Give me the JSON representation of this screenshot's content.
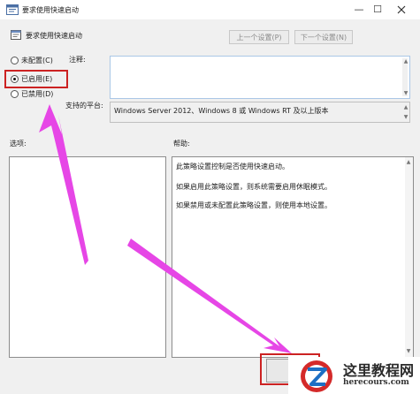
{
  "window": {
    "title": "要求使用快速启动",
    "icon": "policy-settings-icon",
    "minimize_glyph": "—",
    "maximize_glyph": "☐"
  },
  "toolbar": {
    "policy_name": "要求使用快速启动",
    "prev_label": "上一个设置(P)",
    "next_label": "下一个设置(N)"
  },
  "state": {
    "options": [
      {
        "label": "未配置(C)",
        "checked": false
      },
      {
        "label": "已启用(E)",
        "checked": true
      },
      {
        "label": "已禁用(D)",
        "checked": false
      }
    ]
  },
  "fields": {
    "comment_label": "注释:",
    "comment_value": "",
    "supported_label": "支持的平台:",
    "supported_value": "Windows Server 2012、Windows 8 或 Windows RT 及以上版本"
  },
  "panels": {
    "options_label": "选项:",
    "help_label": "帮助:",
    "help_lines": [
      "此策略设置控制是否使用快速启动。",
      "如果启用此策略设置，则系统需要启用休眠模式。",
      "如果禁用或未配置此策略设置，则使用本地设置。"
    ]
  },
  "watermark": {
    "brand": "这里教程网",
    "domain": "herecours.com",
    "logo": "z-logo-icon"
  },
  "colors": {
    "annotation_red": "#cc2222",
    "annotation_arrow": "#e646e6",
    "input_border": "#aac7e6",
    "background": "#f0f0f0"
  }
}
